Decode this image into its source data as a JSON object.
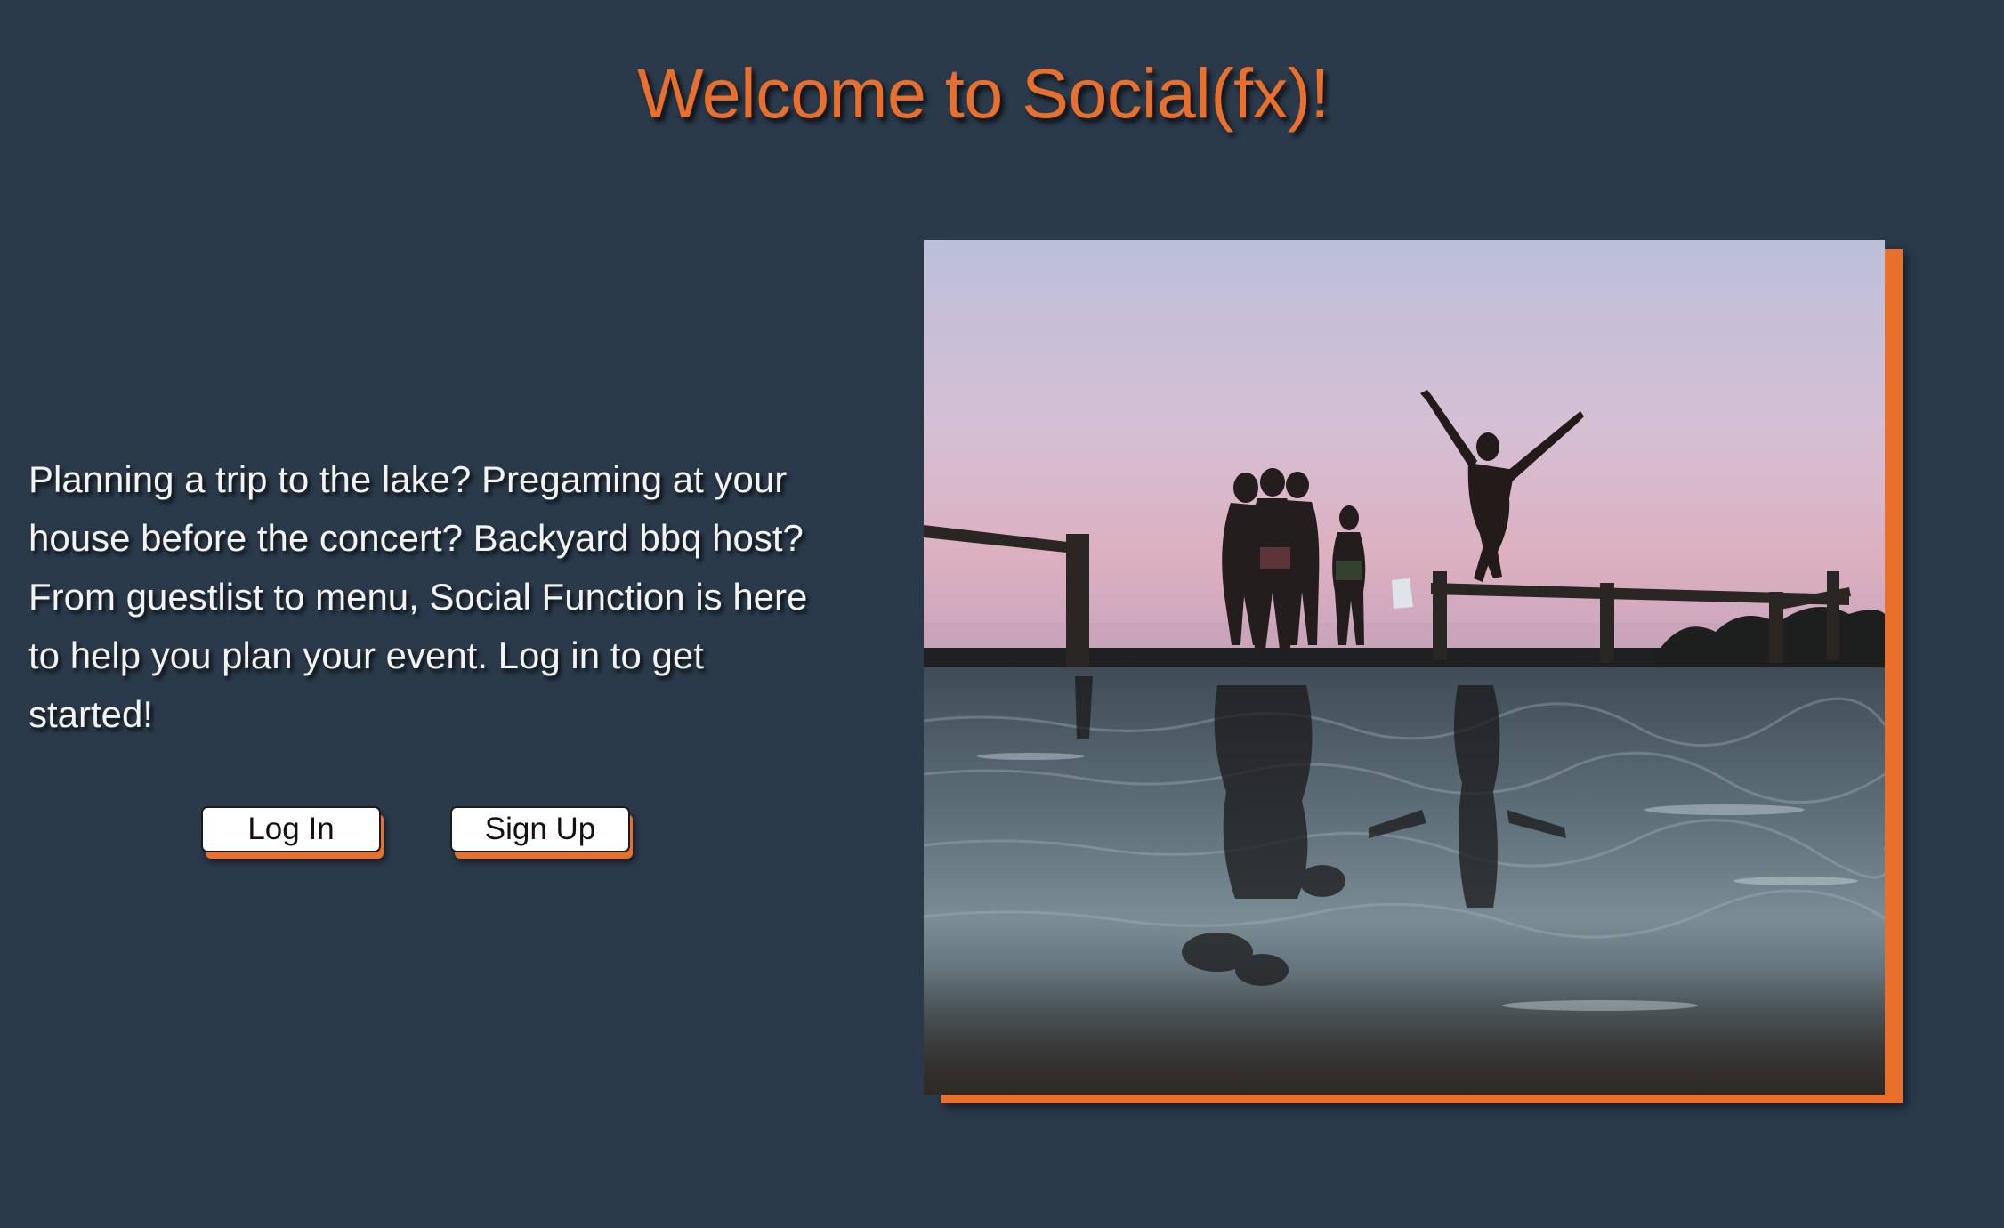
{
  "header": {
    "title": "Welcome to Social(fx)!"
  },
  "intro": {
    "text": "Planning a trip to the lake? Pregaming at your house before the concert? Backyard bbq host? From guestlist to menu, Social Function is here to help you plan your event. Log in to get started!"
  },
  "actions": {
    "login_label": "Log In",
    "signup_label": "Sign Up"
  },
  "hero_image": {
    "subject": "friends-jumping-into-lake-at-sunset"
  },
  "colors": {
    "background": "#2a3a4b",
    "accent": "#e86f2c",
    "text": "#f3f3f3",
    "button_bg": "#ffffff"
  }
}
